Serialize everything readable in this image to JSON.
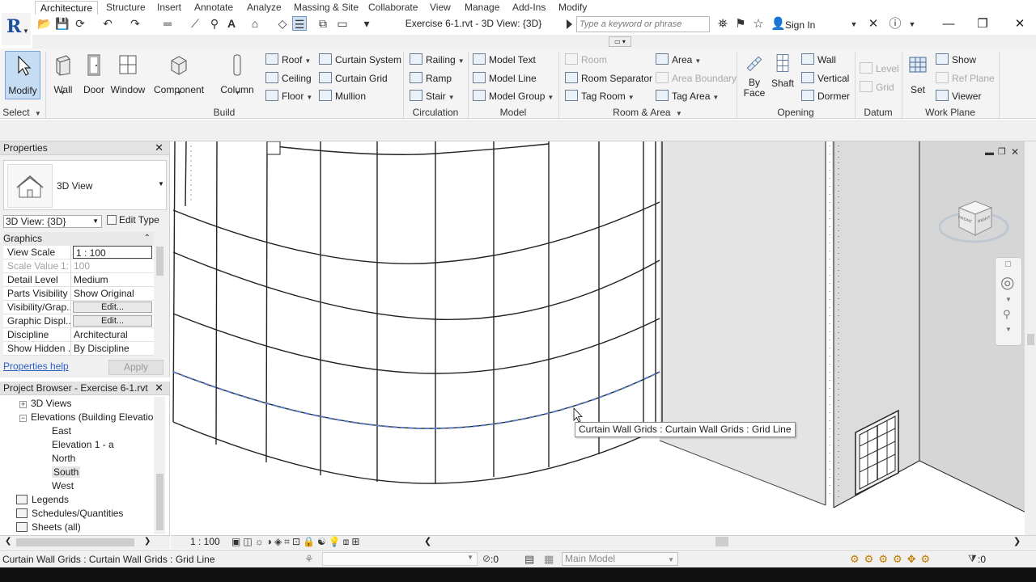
{
  "title_bar": {
    "document_title": "Exercise 6-1.rvt - 3D View: {3D}",
    "search_placeholder": "Type a keyword or phrase",
    "sign_in": "Sign In"
  },
  "tabs": [
    "Architecture",
    "Structure",
    "Insert",
    "Annotate",
    "Analyze",
    "Massing & Site",
    "Collaborate",
    "View",
    "Manage",
    "Add-Ins",
    "Modify"
  ],
  "ribbon": {
    "select": {
      "modify": "Modify",
      "label": "Select"
    },
    "build": {
      "label": "Build",
      "big": [
        "Wall",
        "Door",
        "Window",
        "Component",
        "Column"
      ],
      "small": [
        "Roof",
        "Ceiling",
        "Floor",
        "Curtain System",
        "Curtain Grid",
        "Mullion"
      ]
    },
    "circulation": {
      "label": "Circulation",
      "items": [
        "Railing",
        "Ramp",
        "Stair"
      ]
    },
    "model": {
      "label": "Model",
      "items": [
        "Model Text",
        "Model Line",
        "Model Group"
      ]
    },
    "room_area": {
      "label": "Room & Area",
      "items": [
        "Room",
        "Room Separator",
        "Tag Room",
        "Area",
        "Area Boundary",
        "Tag Area"
      ]
    },
    "opening": {
      "label": "Opening",
      "big": [
        "By Face",
        "Shaft"
      ],
      "small": [
        "Wall",
        "Vertical",
        "Dormer"
      ]
    },
    "datum": {
      "label": "Datum",
      "items": [
        "Level",
        "Grid"
      ]
    },
    "work_plane": {
      "label": "Work Plane",
      "set": "Set",
      "items": [
        "Show",
        "Ref Plane",
        "Viewer"
      ]
    }
  },
  "properties": {
    "header": "Properties",
    "type_name": "3D View",
    "view_selector": "3D View: {3D}",
    "edit_type": "Edit Type",
    "group": "Graphics",
    "rows": [
      {
        "k": "View Scale",
        "v": "1 : 100"
      },
      {
        "k": "Scale Value",
        "v": "100",
        "prefix": "1:"
      },
      {
        "k": "Detail Level",
        "v": "Medium"
      },
      {
        "k": "Parts Visibility",
        "v": "Show Original"
      },
      {
        "k": "Visibility/Grap...",
        "v": "Edit..."
      },
      {
        "k": "Graphic Displ...",
        "v": "Edit..."
      },
      {
        "k": "Discipline",
        "v": "Architectural"
      },
      {
        "k": "Show Hidden ...",
        "v": "By Discipline"
      }
    ],
    "help": "Properties help",
    "apply": "Apply"
  },
  "browser": {
    "header": "Project Browser - Exercise 6-1.rvt",
    "items": [
      "3D Views",
      "Elevations (Building Elevation",
      "East",
      "Elevation 1 - a",
      "North",
      "South",
      "West",
      "Legends",
      "Schedules/Quantities",
      "Sheets (all)"
    ]
  },
  "viewport": {
    "tooltip": "Curtain Wall Grids : Curtain Wall Grids : Grid Line",
    "viewcube_faces": [
      "FRONT",
      "RIGHT"
    ]
  },
  "view_bar": {
    "scale": "1 : 100"
  },
  "status": {
    "text": "Curtain Wall Grids : Curtain Wall Grids : Grid Line",
    "selection_count": ":0",
    "workset": "Main Model",
    "filter_count": ":0"
  }
}
